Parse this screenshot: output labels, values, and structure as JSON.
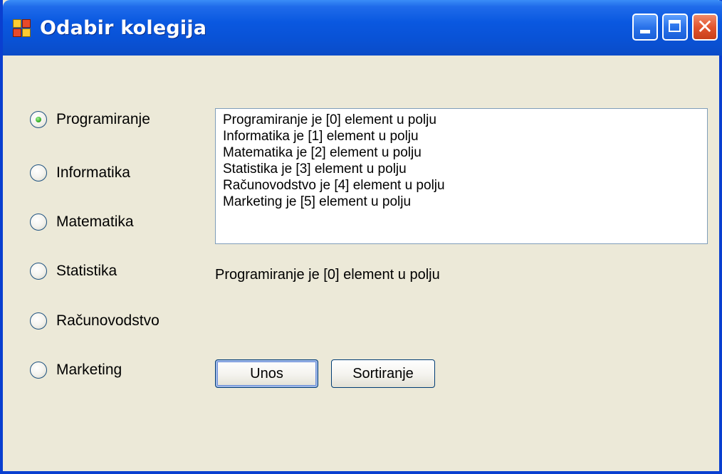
{
  "window": {
    "title": "Odabir kolegija"
  },
  "radios": [
    {
      "label": "Programiranje",
      "checked": true
    },
    {
      "label": "Informatika",
      "checked": false
    },
    {
      "label": "Matematika",
      "checked": false
    },
    {
      "label": "Statistika",
      "checked": false
    },
    {
      "label": "Računovodstvo",
      "checked": false
    },
    {
      "label": "Marketing",
      "checked": false
    }
  ],
  "list": {
    "items": [
      "Programiranje je [0] element u polju",
      "Informatika je [1] element u polju",
      "Matematika je [2] element u polju",
      "Statistika je [3] element u polju",
      "Računovodstvo je [4] element u polju",
      "Marketing je [5] element u polju"
    ]
  },
  "result_label": "Programiranje je [0] element u polju",
  "buttons": {
    "unos": "Unos",
    "sortiranje": "Sortiranje"
  },
  "colors": {
    "titlebar": "#0a58e0",
    "window_bg": "#ece9d8",
    "close_button": "#e2552e"
  }
}
